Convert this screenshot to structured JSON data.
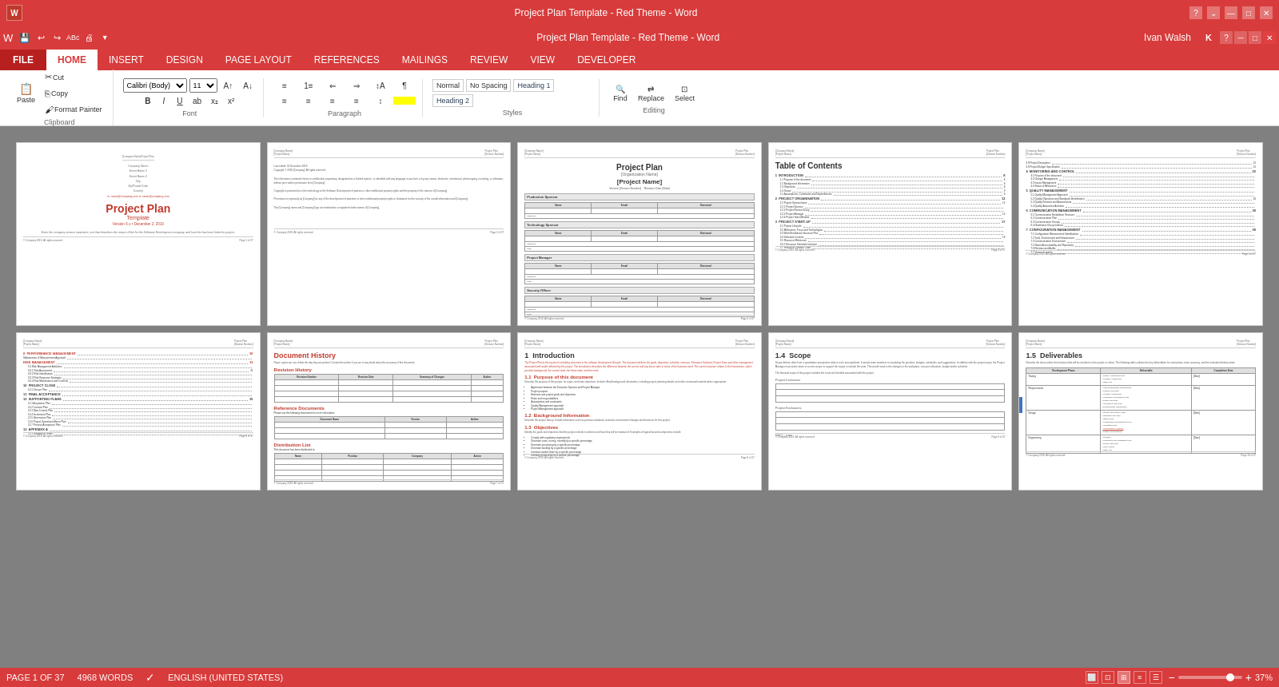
{
  "titlebar": {
    "title": "Project Plan Template - Red Theme - Word",
    "min_label": "—",
    "max_label": "□",
    "close_label": "✕",
    "help_label": "?"
  },
  "quickaccess": {
    "buttons": [
      "💾",
      "↩",
      "↪",
      "ABc",
      "☑",
      "⬜"
    ]
  },
  "ribbon": {
    "tabs": [
      "FILE",
      "HOME",
      "INSERT",
      "DESIGN",
      "PAGE LAYOUT",
      "REFERENCES",
      "MAILINGS",
      "REVIEW",
      "VIEW",
      "DEVELOPER"
    ],
    "active_tab": "HOME",
    "file_tab": "FILE",
    "user_name": "Ivan Walsh",
    "user_initial": "K"
  },
  "statusbar": {
    "page_info": "PAGE 1 OF 37",
    "word_count": "4968 WORDS",
    "language": "ENGLISH (UNITED STATES)",
    "zoom": "37%"
  },
  "pages": [
    {
      "id": "page1",
      "type": "cover",
      "company_name": "[Company Name]",
      "event1": "Event Name 1",
      "event2": "Event Name 2",
      "city_state": "City",
      "zip": "Zip/Postal Code",
      "country": "Country",
      "email": "m: name@company.com or name@company.com",
      "title": "Project Plan",
      "subtitle": "Template",
      "version": "Version X.x • December 2, 2019",
      "desc": "Enter the company mission statement, one that describes the reason d'être for the Software Development company, and how this has been linked to project."
    },
    {
      "id": "page2",
      "type": "legal",
      "last_edited": "Last edited: 01 December 2019",
      "copyright": "Copyright © 2019 [Company]. All rights reserved."
    },
    {
      "id": "page3",
      "type": "project-form",
      "main_title": "Project Plan",
      "org_name": "[Organization Name]",
      "project_name": "[Project Name]",
      "version": "Version [Version Number]",
      "revision": "Revision Date [Date]"
    },
    {
      "id": "page4",
      "type": "toc",
      "title": "Table of Contents",
      "items": [
        {
          "label": "1  INTRODUCTION",
          "page": "8"
        },
        {
          "label": "1.1  Purpose of the document",
          "page": "8"
        },
        {
          "label": "1.2  Background Information",
          "page": "8"
        },
        {
          "label": "1.3  Objectives",
          "page": "8"
        },
        {
          "label": "1.4  Scope",
          "page": "9"
        },
        {
          "label": "1.5  Assumptions, Constraints and Dependencies",
          "page": "9"
        },
        {
          "label": "1.5.1  Assumptions",
          "page": ""
        },
        {
          "label": "1.5.2  Monitoring",
          "page": ""
        },
        {
          "label": "1.5.3  Dependencies",
          "page": ""
        },
        {
          "label": "2  PROJECT ORGANISATION",
          "page": "12"
        },
        {
          "label": "2.1  Organisational items",
          "page": ""
        },
        {
          "label": "2.2  Project Sponsor/aims",
          "page": "12"
        },
        {
          "label": "2.2.1  Project Sponsor",
          "page": ""
        },
        {
          "label": "2.2.2  Project Review Group",
          "page": ""
        },
        {
          "label": "2.2.3  Project Manager",
          "page": "15"
        },
        {
          "label": "2.2.4  Project Team Member",
          "page": ""
        },
        {
          "label": "2.3  Governance: Materials and Deliverables",
          "page": ""
        },
        {
          "label": "2.4  Work Breakdown Structure Plan",
          "page": ""
        },
        {
          "label": "2.5  Configuration Materials and Constraints",
          "page": ""
        },
        {
          "label": "3  PROJECT START-UP",
          "page": "17"
        },
        {
          "label": "3.1  Project Lifecycle",
          "page": ""
        },
        {
          "label": "3.2  Milestones, Focus and Technologies",
          "page": ""
        },
        {
          "label": "3.3  Work Breakdown Structure Plan",
          "page": ""
        },
        {
          "label": "3.4  Schedule Controls",
          "page": "19"
        },
        {
          "label": "3.4.1  Schedule Content Iteration",
          "page": ""
        },
        {
          "label": "3.5  Resource Milestones",
          "page": ""
        },
        {
          "label": "3.6.1  Resource Schedule Inclusion",
          "page": ""
        },
        {
          "label": "3.6.2  Resource Schedule Inclusion",
          "page": ""
        },
        {
          "label": "3.7  Resource Location Chart",
          "page": ""
        }
      ]
    },
    {
      "id": "page5",
      "type": "toc-cont",
      "items": [
        {
          "label": "3.8  Project Description",
          "page": "21"
        },
        {
          "label": "3.9  Project Budget Specification",
          "page": "21"
        },
        {
          "label": "4  MONITORING AND CONTROL",
          "page": "22"
        },
        {
          "label": "4.1  Purpose of the document",
          "page": ""
        },
        {
          "label": "4.2  Change Management",
          "page": ""
        },
        {
          "label": "4.3  Issues Management",
          "page": ""
        },
        {
          "label": "4.4  Status of Milestones",
          "page": ""
        },
        {
          "label": "4.5  Status Content",
          "page": ""
        },
        {
          "label": "4.5.1  Visibility",
          "page": ""
        },
        {
          "label": "4.5.2  Monitoring",
          "page": ""
        },
        {
          "label": "4.6  Subcontractor Management",
          "page": ""
        },
        {
          "label": "4.7  Process Improvement",
          "page": ""
        },
        {
          "label": "5  QUALITY MANAGEMENT",
          "page": ""
        },
        {
          "label": "5.1  Quality Management Approach",
          "page": ""
        },
        {
          "label": "5.2  Quality Objectives and Standards Identification",
          "page": "24"
        },
        {
          "label": "5.3  Quality Reviews and Assessments",
          "page": ""
        },
        {
          "label": "5.4  Quality Assurance Activities",
          "page": ""
        },
        {
          "label": "5.5  Process Improvement Activities",
          "page": ""
        },
        {
          "label": "6  COMMUNICATION MANAGEMENT",
          "page": "30"
        },
        {
          "label": "6.1  Communication Breakdown Structure",
          "page": ""
        },
        {
          "label": "6.2  Communication Plan",
          "page": ""
        },
        {
          "label": "6.3  Communication Groups",
          "page": ""
        },
        {
          "label": "6.4  Distribution Group Indexes",
          "page": ""
        },
        {
          "label": "7  CONFIGURATION MANAGEMENT",
          "page": "30"
        },
        {
          "label": "7.1  Configuration Measurement Identification",
          "page": ""
        },
        {
          "label": "7.2  Tools, Environment and Infrastructure",
          "page": ""
        },
        {
          "label": "7.3  Communication Environment",
          "page": ""
        },
        {
          "label": "7.4  Communication Criteria",
          "page": ""
        },
        {
          "label": "7.5  Status Accountability and Repository",
          "page": ""
        },
        {
          "label": "7.6  Reviews and Audits",
          "page": ""
        },
        {
          "label": "7.7  Version Controls",
          "page": ""
        }
      ]
    },
    {
      "id": "page6",
      "type": "toc-cont2",
      "items": [
        {
          "label": "8  PERFORMANCE MANAGEMENT",
          "page": "30"
        },
        {
          "label": "9  AWARENESS OF MEASUREMENT APPROACH",
          "page": ""
        },
        {
          "label": "RISK MANAGEMENT",
          "page": "31"
        },
        {
          "label": "9.1  Risk Management Attributes",
          "page": ""
        },
        {
          "label": "9.2.1  Risk Assessment",
          "page": "31"
        },
        {
          "label": "9.2.2  Risk Identification",
          "page": ""
        },
        {
          "label": "9.2.3  Risk Response Strategies",
          "page": ""
        },
        {
          "label": "9.2.4  Risk Maintenance and Contents",
          "page": ""
        },
        {
          "label": "10  PROJECT CLOSE",
          "page": ""
        },
        {
          "label": "10.1  Closure Plan",
          "page": ""
        },
        {
          "label": "11  FINAL ACCEPTANCE",
          "page": ""
        },
        {
          "label": "12  SUPPORTING PLANS",
          "page": "35"
        },
        {
          "label": "12.1  Acquisition Plan",
          "page": ""
        },
        {
          "label": "12.2  Contract Plan",
          "page": ""
        },
        {
          "label": "12.3  Data Content Plan",
          "page": ""
        },
        {
          "label": "12.4  Increments Plan",
          "page": ""
        },
        {
          "label": "12.5  Dimensions Plan",
          "page": ""
        },
        {
          "label": "12.6  Project Operations Memo Plan",
          "page": ""
        },
        {
          "label": "12.7  Process Acceptance Plan",
          "page": ""
        },
        {
          "label": "13  APPENDIX A",
          "page": ""
        },
        {
          "label": "13.1  Glossary of Terms",
          "page": ""
        }
      ]
    },
    {
      "id": "page7",
      "type": "doc-history",
      "title": "Document History",
      "intro": "Paper copies are out of date the day they are printed. Contact the author if you are in any doubt about the accuracy of this document.",
      "revision_title": "Revision History",
      "revision_cols": [
        "Revision Number",
        "Revision Date",
        "Summary of Changes",
        "Author"
      ],
      "reference_title": "Reference Documents",
      "reference_cols": [
        "Document Name",
        "Version",
        "Author"
      ],
      "distribution_title": "Distribution List",
      "distribution_text": "This document has been distributed to:",
      "distribution_cols": [
        "Name",
        "Position",
        "Company",
        "Action"
      ]
    },
    {
      "id": "page8",
      "type": "introduction",
      "section": "1",
      "title": "Introduction",
      "intro_text": "The Project Plan is the top level controlling document in the software development lifecycle. The document defines the goals, objectives, schedule, resource, Enterprise Solutions Project Team and other management associated with and/or affected by the project. The introduction describes the differences between the current and any future state in terms of the business need. The current structure relates to the Introduction, which provides background, the current state, the future state, and the need.",
      "h1_1": "1.1  Purpose of this document",
      "purpose_text": "Describe the purpose of this project: its scope, and main objectives. Include official background information, including project planning details, and other contextual material where appropriate.",
      "purpose_items": [
        "Agreement between the Executive Sponsor and Project Manager",
        "Project purpose",
        "Business and project goals and objectives",
        "Roles and responsibilities",
        "Assumptions and constraints",
        "Quality Management approach",
        "Project Management approach"
      ],
      "h1_2": "1.2  Background Information",
      "background_text": "Describe the project history. Include information such as previous initiatives, business environment changes and decisions for this project.",
      "h1_3": "1.3  Objectives",
      "objectives_text": "Identify the goals and objectives that the project intends to achieve and how they will be measured. Examples of typical business objectives include:",
      "objectives_items": [
        "Comply with regulatory requirements",
        "Decrease costs, money, monthly by a specific percentage",
        "Decrease processing by a specific percentage",
        "Decrease backlog by a specific percentage",
        "Increase market share by a specific percentage",
        "Increase productivity by a specific percentage"
      ]
    },
    {
      "id": "page9",
      "type": "scope",
      "section": "1.4",
      "title": "Scope",
      "scope_text": "Scope defines other from a quantitative perspective what is to be accomplished. It assists team members in visualizing the priorities, budgets, schedules, and suggestions. In addition with the project scope, the Project Manager must action down to a micro-scope to support the output or include the write. This would result in the changes in the workplace, resource allocation, budget and/or schedule.",
      "financial_text": "The financial scope of this project includes the costs and benefits associated with this project."
    },
    {
      "id": "page10",
      "type": "deliverables",
      "section": "1.5",
      "title": "Deliverables",
      "deliverables_text": "Describe the items and/or the functions that will be included on the project or rollout. The following table outlines the key deliverables for each phase, team summary, and the estimated delivery date.",
      "cols": [
        "Development Phase",
        "Deliverable",
        "Completion Date"
      ],
      "rows": [
        {
          "phase": "Testing",
          "deliverables": [
            "Quality Assessment Plan",
            "In-Stage Assessment",
            "Stage List"
          ],
          "date": "[Date]"
        },
        {
          "phase": "Requirements",
          "deliverables": [
            "Unit Requirements Specification",
            "Capacity Planning",
            "In-Stage Assessment",
            "Catalogue of Operations Plan",
            "Project Test Plan",
            "Acceptance Test Plan",
            "Requirements Specification"
          ],
          "date": "[Date]"
        },
        {
          "phase": "Design",
          "deliverables": [
            "Security and Privacy plan (highlighted red)",
            "Integrated Test Plan",
            "Testing Plan (text)",
            "Configuration Management Plan",
            "Acquisition Plan",
            "Undeveloped S deleted (red)",
            "Design Specifications"
          ],
          "date": "[Date]"
        },
        {
          "phase": "Engineering",
          "deliverables": [
            "Software",
            "Conversion and Installation Plan",
            "System Test Plan",
            "User's Guide",
            "Stage List"
          ],
          "date": "[Date]"
        }
      ]
    }
  ]
}
